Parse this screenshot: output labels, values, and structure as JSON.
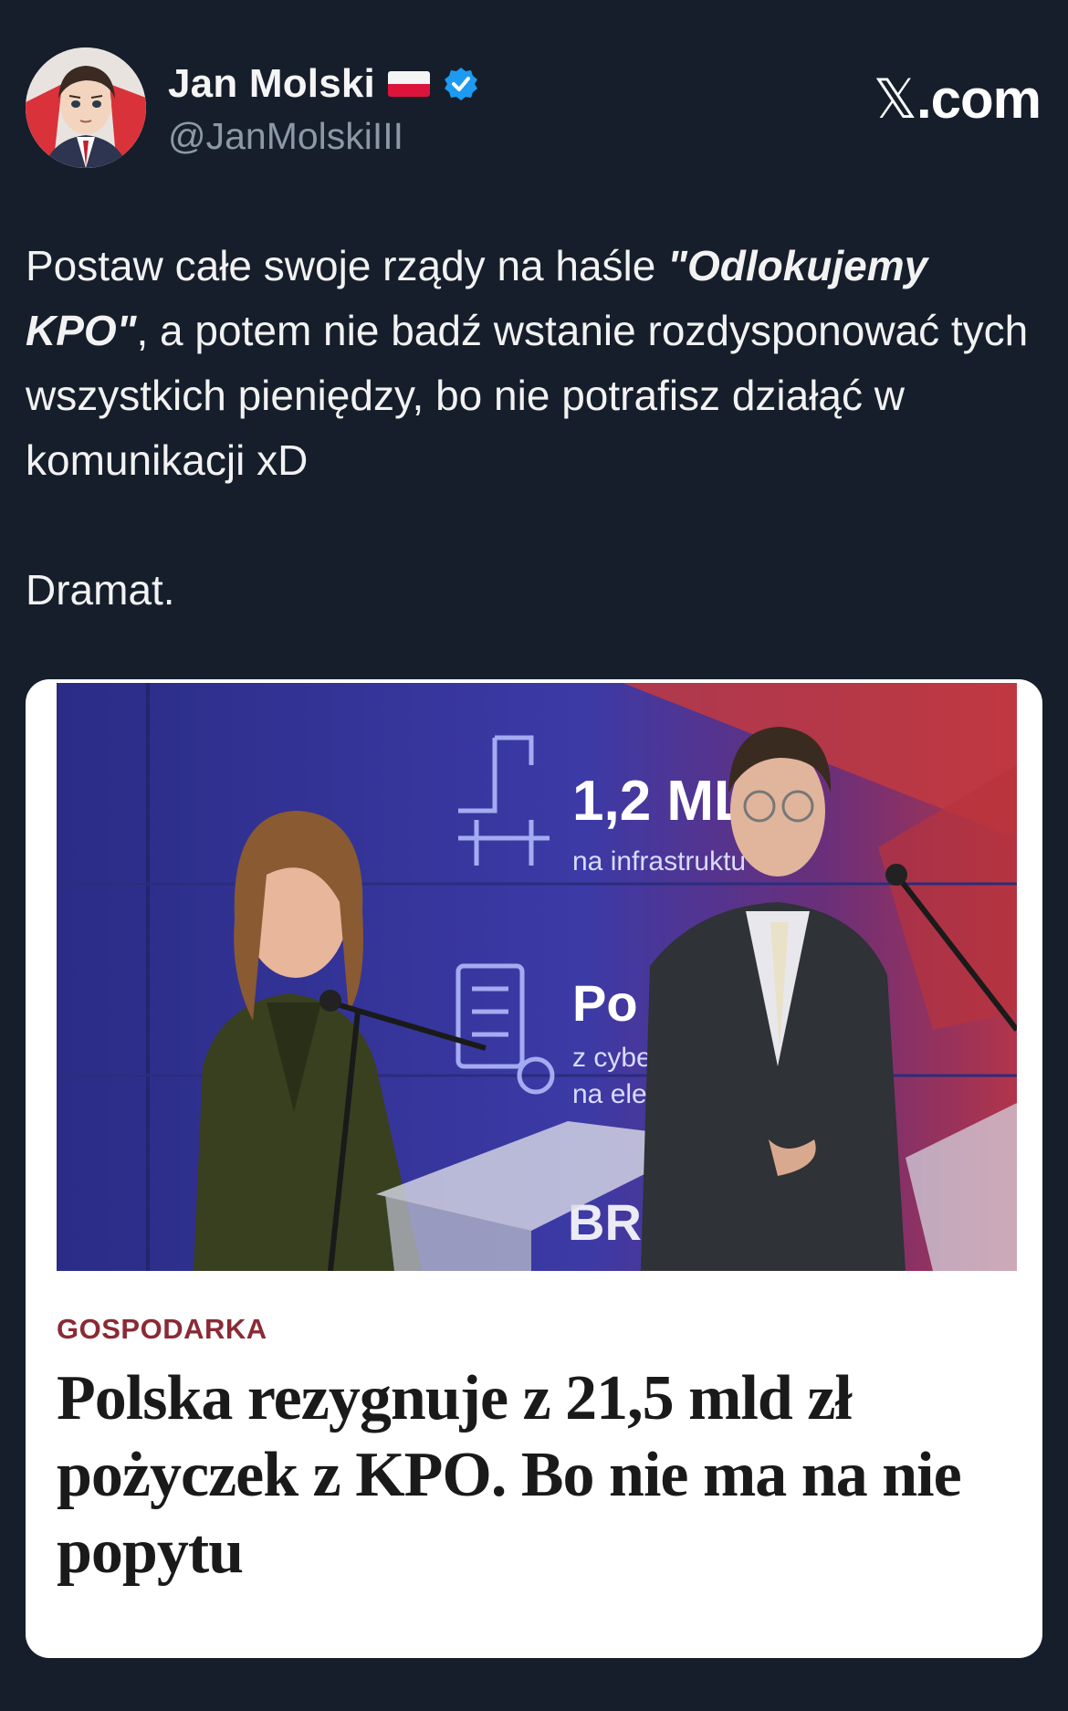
{
  "author": {
    "display_name": "Jan Molski",
    "handle": "@JanMolskiIII",
    "flag_icon": "poland-flag-icon",
    "verified_icon": "verified-badge-icon",
    "verified_color": "#1d9bf0"
  },
  "brand": {
    "label_suffix": ".com",
    "label_glyph": "𝕏"
  },
  "tweet": {
    "prefix": "Postaw całe swoje rządy na haśle ",
    "emphasis": "\"Odlokujemy KPO\"",
    "suffix": ", a potem nie badź wstanie rozdysponować tych wszystkich pieniędzy, bo nie potrafisz działąć w komunikacji xD",
    "second_paragraph": "Dramat."
  },
  "card": {
    "category": "GOSPODARKA",
    "headline": "Polska rezygnuje z 21,5 mld zł pożyczek z KPO. Bo nie ma na nie popytu",
    "image_texts": {
      "stat1_value": "1,2 MLD",
      "stat1_caption": "na infrastruktu",
      "stat2_value": "Po 13",
      "stat2_caption_a": "z cyber",
      "stat2_caption_b": "na elek",
      "bottom_word": "BRAI"
    },
    "category_color": "#8a2a35"
  },
  "colors": {
    "background": "#161e2b",
    "text": "#f2f2f2",
    "handle": "#8b98a5",
    "card_bg": "#ffffff"
  }
}
